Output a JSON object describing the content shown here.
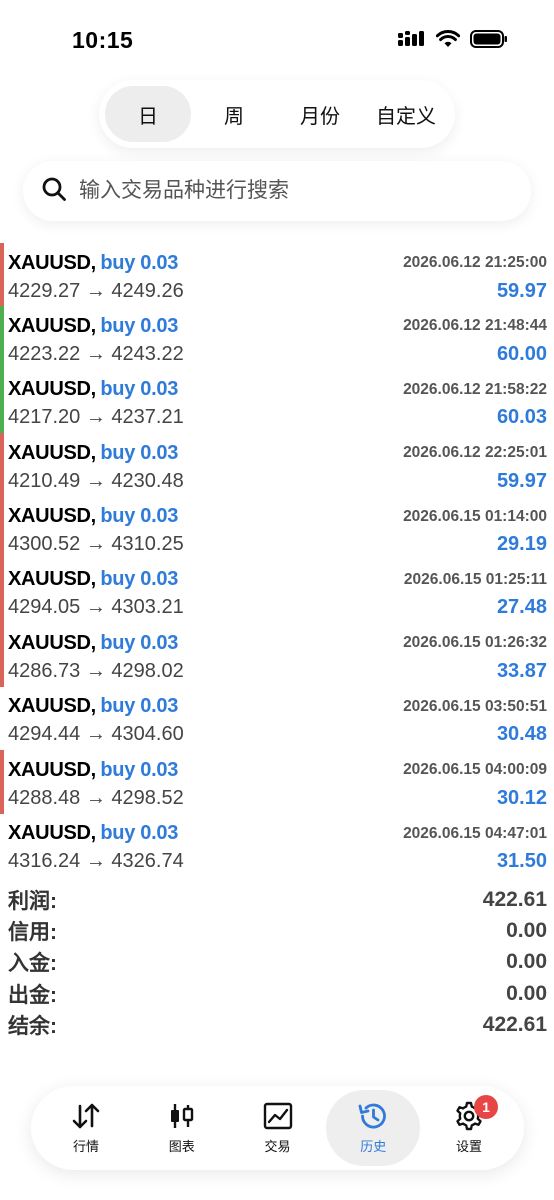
{
  "status_bar": {
    "time": "10:15"
  },
  "period_tabs": [
    {
      "label": "日",
      "active": true
    },
    {
      "label": "周",
      "active": false
    },
    {
      "label": "月份",
      "active": false
    },
    {
      "label": "自定义",
      "active": false
    }
  ],
  "search": {
    "placeholder": "输入交易品种进行搜索",
    "value": ""
  },
  "deals": [
    {
      "symbol": "XAUUSD,",
      "side": "buy 0.03",
      "time": "2026.06.12 21:25:00",
      "prices": "4229.27 → 4249.26",
      "profit": "59.97",
      "bar_color": "#d9645a"
    },
    {
      "symbol": "XAUUSD,",
      "side": "buy 0.03",
      "time": "2026.06.12 21:48:44",
      "prices": "4223.22 → 4243.22",
      "profit": "60.00",
      "bar_color": "#4caf50"
    },
    {
      "symbol": "XAUUSD,",
      "side": "buy 0.03",
      "time": "2026.06.12 21:58:22",
      "prices": "4217.20 → 4237.21",
      "profit": "60.03",
      "bar_color": "#4caf50"
    },
    {
      "symbol": "XAUUSD,",
      "side": "buy 0.03",
      "time": "2026.06.12 22:25:01",
      "prices": "4210.49 → 4230.48",
      "profit": "59.97",
      "bar_color": "#d9645a"
    },
    {
      "symbol": "XAUUSD,",
      "side": "buy 0.03",
      "time": "2026.06.15 01:14:00",
      "prices": "4300.52 → 4310.25",
      "profit": "29.19",
      "bar_color": "#d9645a"
    },
    {
      "symbol": "XAUUSD,",
      "side": "buy 0.03",
      "time": "2026.06.15 01:25:11",
      "prices": "4294.05 → 4303.21",
      "profit": "27.48",
      "bar_color": "#d9645a"
    },
    {
      "symbol": "XAUUSD,",
      "side": "buy 0.03",
      "time": "2026.06.15 01:26:32",
      "prices": "4286.73 → 4298.02",
      "profit": "33.87",
      "bar_color": "#d9645a"
    },
    {
      "symbol": "XAUUSD,",
      "side": "buy 0.03",
      "time": "2026.06.15 03:50:51",
      "prices": "4294.44 → 4304.60",
      "profit": "30.48",
      "bar_color": ""
    },
    {
      "symbol": "XAUUSD,",
      "side": "buy 0.03",
      "time": "2026.06.15 04:00:09",
      "prices": "4288.48 → 4298.52",
      "profit": "30.12",
      "bar_color": "#d9645a"
    },
    {
      "symbol": "XAUUSD,",
      "side": "buy 0.03",
      "time": "2026.06.15 04:47:01",
      "prices": "4316.24 → 4326.74",
      "profit": "31.50",
      "bar_color": ""
    }
  ],
  "summary": [
    {
      "label": "利润:",
      "value": "422.61"
    },
    {
      "label": "信用:",
      "value": "0.00"
    },
    {
      "label": "入金:",
      "value": "0.00"
    },
    {
      "label": "出金:",
      "value": "0.00"
    },
    {
      "label": "结余:",
      "value": "422.61"
    }
  ],
  "bottom_nav": [
    {
      "label": "行情",
      "icon": "quotes-arrows-icon",
      "active": false
    },
    {
      "label": "图表",
      "icon": "candlestick-chart-icon",
      "active": false
    },
    {
      "label": "交易",
      "icon": "trade-line-chart-icon",
      "active": false
    },
    {
      "label": "历史",
      "icon": "history-clock-icon",
      "active": true
    },
    {
      "label": "设置",
      "icon": "gear-icon",
      "active": false,
      "badge": "1"
    }
  ],
  "colors": {
    "accent": "#2f7bd9",
    "loss_bar": "#d9645a",
    "win_bar": "#4caf50",
    "badge": "#e84545"
  }
}
